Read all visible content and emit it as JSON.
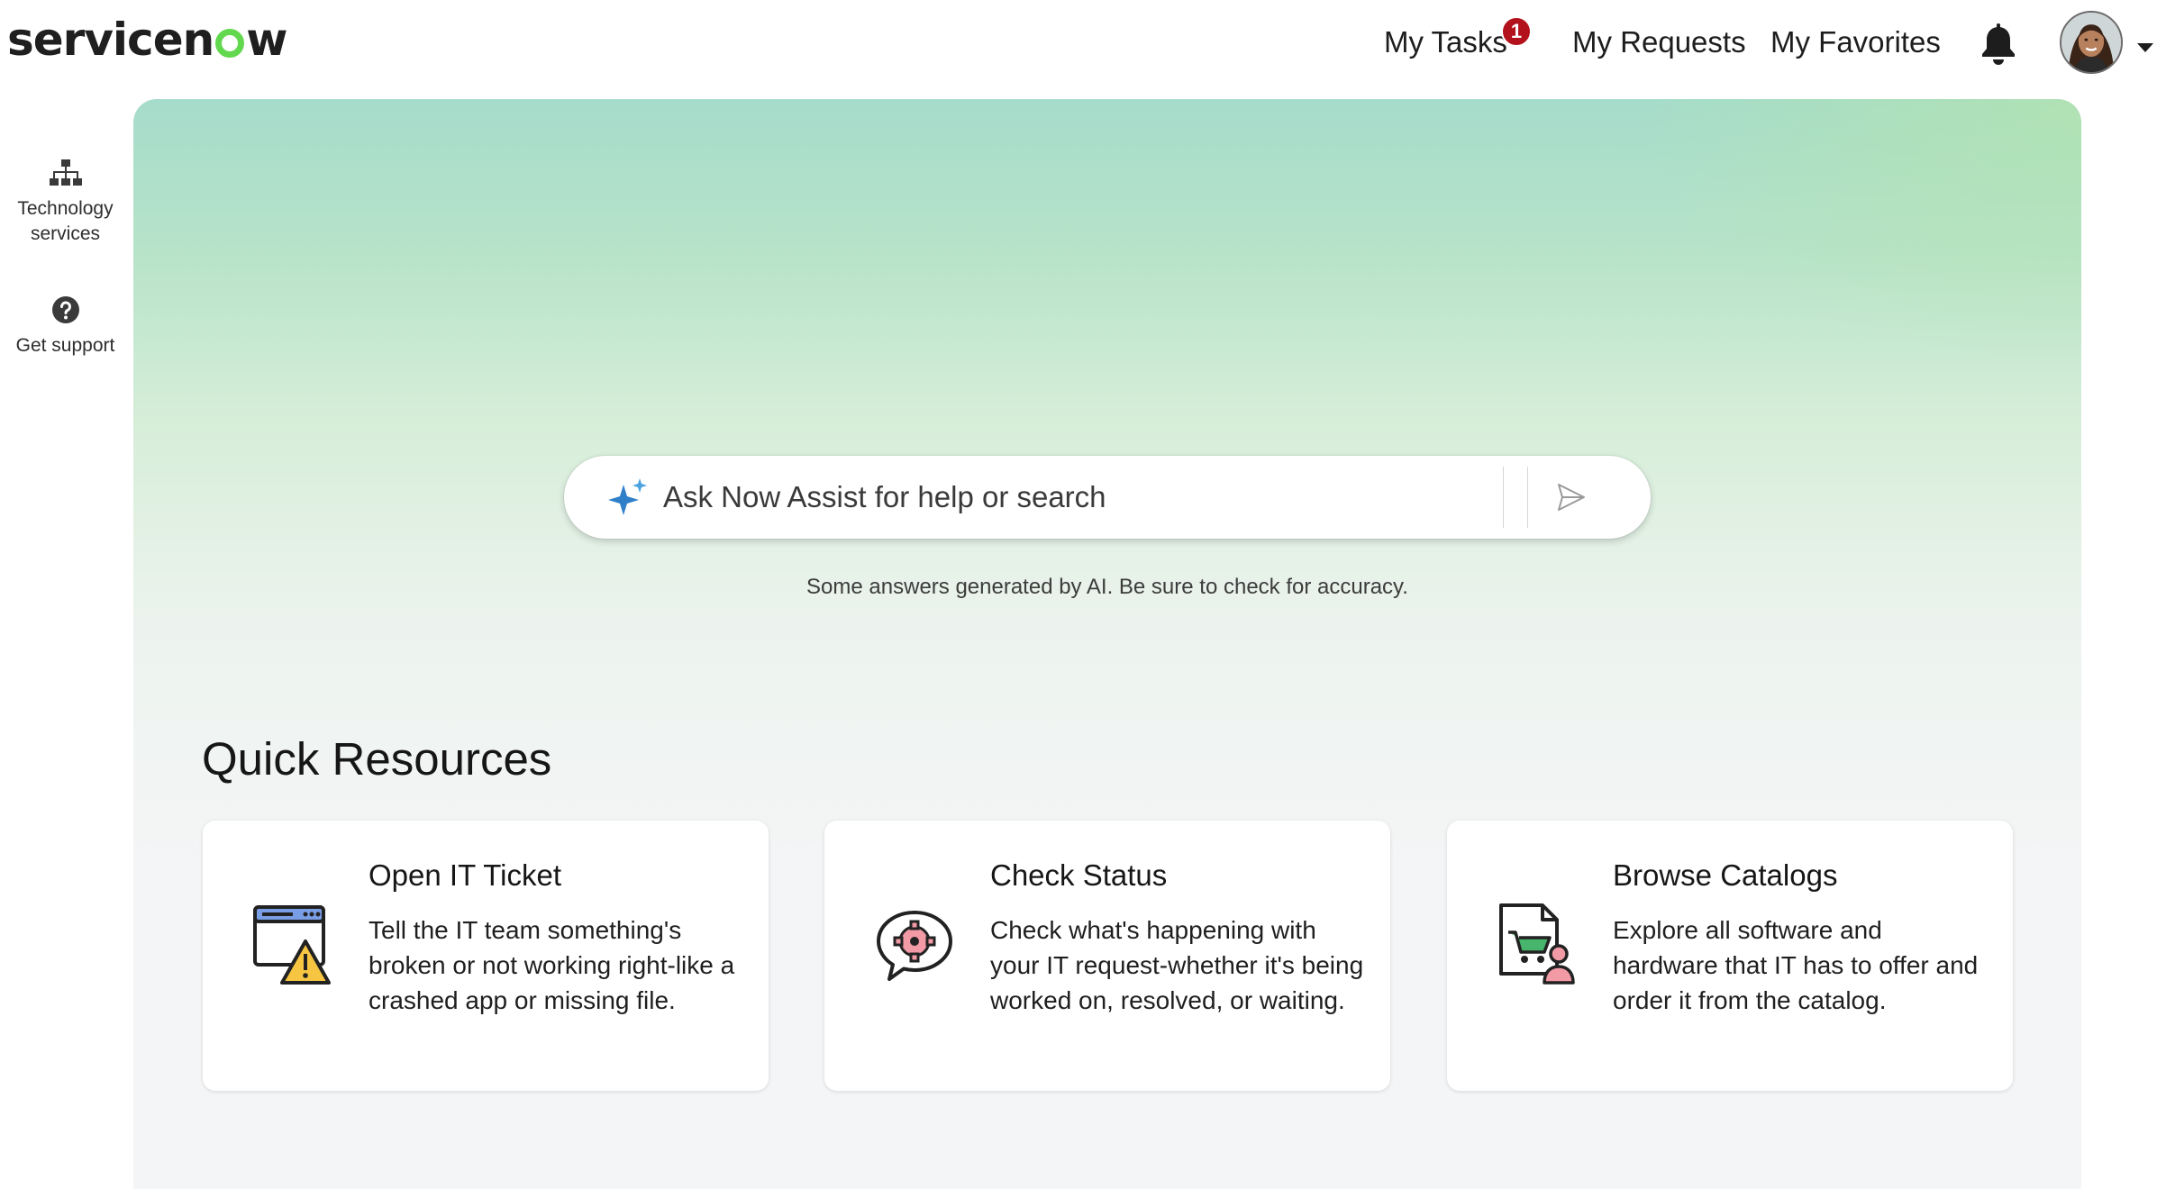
{
  "header": {
    "logo_prefix": "servicen",
    "logo_suffix": "w",
    "nav": {
      "my_tasks": "My Tasks",
      "my_tasks_badge": "1",
      "my_requests": "My Requests",
      "my_favorites": "My Favorites"
    },
    "icons": [
      "bell-icon",
      "avatar",
      "chevron-down-icon"
    ]
  },
  "rail": {
    "items": [
      {
        "label": "Technology services",
        "icon": "hierarchy-icon"
      },
      {
        "label": "Get support",
        "icon": "question-circle-icon"
      }
    ]
  },
  "search": {
    "placeholder": "Ask Now Assist for help or search",
    "disclaimer": "Some answers generated by AI. Be sure to check for accuracy."
  },
  "quick_resources": {
    "title": "Quick Resources",
    "cards": [
      {
        "title": "Open IT Ticket",
        "description": "Tell the IT team something's broken or not working right-like a crashed app or missing file.",
        "icon": "browser-warning-icon"
      },
      {
        "title": "Check Status",
        "description": "Check what's happening with your IT request-whether it's being worked on, resolved, or waiting.",
        "icon": "chat-gear-icon"
      },
      {
        "title": "Browse Catalogs",
        "description": "Explore all software and hardware that IT has to offer and order it from the catalog.",
        "icon": "catalog-cart-icon"
      }
    ]
  },
  "colors": {
    "accent_green": "#62d84e",
    "badge_red": "#b3121c",
    "spark_blue": "#2f7fc9"
  }
}
